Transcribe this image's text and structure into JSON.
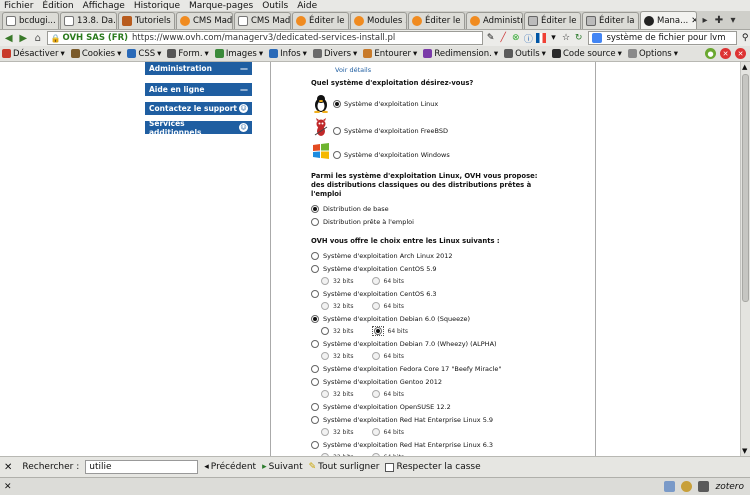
{
  "menubar": [
    "Fichier",
    "Édition",
    "Affichage",
    "Historique",
    "Marque-pages",
    "Outils",
    "Aide"
  ],
  "tabs": [
    {
      "label": "bcdugi...",
      "icon": "document-icon",
      "active": false
    },
    {
      "label": "13.8. Da...",
      "icon": "document-icon",
      "active": false
    },
    {
      "label": "Tutoriels ...",
      "icon": "tutorials-icon",
      "active": false
    },
    {
      "label": "CMS Mad...",
      "icon": "cms-icon",
      "active": false
    },
    {
      "label": "CMS Mad...",
      "icon": "document-icon",
      "active": false
    },
    {
      "label": "Éditer le ...",
      "icon": "cms-icon",
      "active": false
    },
    {
      "label": "Modules ...",
      "icon": "cms-icon",
      "active": false
    },
    {
      "label": "Éditer le ...",
      "icon": "cms-icon",
      "active": false
    },
    {
      "label": "Administr...",
      "icon": "cms-icon",
      "active": false
    },
    {
      "label": "Éditer le ...",
      "icon": "page-icon",
      "active": false
    },
    {
      "label": "Éditer la ...",
      "icon": "page-icon",
      "active": false
    },
    {
      "label": "Mana...",
      "icon": "ovh-icon",
      "active": true
    }
  ],
  "nav": {
    "site_id": "OVH SAS (FR)",
    "url": "https://www.ovh.com/managerv3/dedicated-services-install.pl",
    "search_text": "système de fichier pour lvm"
  },
  "devbar": [
    {
      "label": "Désactiver",
      "color": "#c83a2a"
    },
    {
      "label": "Cookies",
      "color": "#7a5a2a"
    },
    {
      "label": "CSS",
      "color": "#2a6ab8"
    },
    {
      "label": "Form.",
      "color": "#555555"
    },
    {
      "label": "Images",
      "color": "#3a8a3a"
    },
    {
      "label": "Infos",
      "color": "#2a6ab8"
    },
    {
      "label": "Divers",
      "color": "#6a6a6a"
    },
    {
      "label": "Entourer",
      "color": "#c87a2a"
    },
    {
      "label": "Redimension.",
      "color": "#7a3aa8"
    },
    {
      "label": "Outils",
      "color": "#5a5a5a"
    },
    {
      "label": "Code source",
      "color": "#2a2a2a"
    },
    {
      "label": "Options",
      "color": "#8a8a8a"
    }
  ],
  "leftmenu": [
    {
      "label": "Administration",
      "icon": "minus-icon"
    },
    {
      "label": "Aide en ligne",
      "icon": "minus-icon"
    },
    {
      "label": "Contactez le support",
      "icon": "support-icon"
    },
    {
      "label": "Services additionnels",
      "icon": "services-icon"
    }
  ],
  "main": {
    "voir_details": "Voir détails",
    "q1": "Quel système d'exploitation désirez-vous?",
    "os_families": [
      {
        "label": "Système d'exploitation Linux",
        "icon": "tux-icon",
        "selected": true
      },
      {
        "label": "Système d'exploitation FreeBSD",
        "icon": "bsd-daemon-icon",
        "selected": false
      },
      {
        "label": "Système d'exploitation Windows",
        "icon": "windows-icon",
        "selected": false
      }
    ],
    "q2": "Parmi les système d'exploitation Linux, OVH vous propose: des distributions classiques ou des distributions prêtes à l'emploi",
    "dist_types": [
      {
        "label": "Distribution de base",
        "selected": true
      },
      {
        "label": "Distribution prête à l'emploi",
        "selected": false
      }
    ],
    "q3": "OVH vous offre le choix entre les Linux suivants :",
    "distros": [
      {
        "label": "Système d'exploitation Arch Linux 2012",
        "selected": false,
        "bits": false
      },
      {
        "label": "Système d'exploitation CentOS 5.9",
        "selected": false,
        "bits": true
      },
      {
        "label": "Système d'exploitation CentOS 6.3",
        "selected": false,
        "bits": true
      },
      {
        "label": "Système d'exploitation Debian 6.0 (Squeeze)",
        "selected": true,
        "bits": true,
        "bits_selected": "64"
      },
      {
        "label": "Système d'exploitation Debian 7.0 (Wheezy) (ALPHA)",
        "selected": false,
        "bits": true
      },
      {
        "label": "Système d'exploitation Fedora Core 17 \"Beefy Miracle\"",
        "selected": false,
        "bits": false
      },
      {
        "label": "Système d'exploitation Gentoo 2012",
        "selected": false,
        "bits": true
      },
      {
        "label": "Système d'exploitation OpenSUSE 12.2",
        "selected": false,
        "bits": false
      },
      {
        "label": "Système d'exploitation Red Hat Enterprise Linux 5.9",
        "selected": false,
        "bits": true
      },
      {
        "label": "Système d'exploitation Red Hat Enterprise Linux 6.3",
        "selected": false,
        "bits": true
      }
    ],
    "bits32": "32 bits",
    "bits64": "64 bits"
  },
  "findbar": {
    "label": "Rechercher :",
    "value": "utilie",
    "prev": "Précédent",
    "next": "Suivant",
    "highlight": "Tout surligner",
    "matchcase": "Respecter la casse"
  },
  "statusbar": {
    "zotero": "zotero"
  }
}
